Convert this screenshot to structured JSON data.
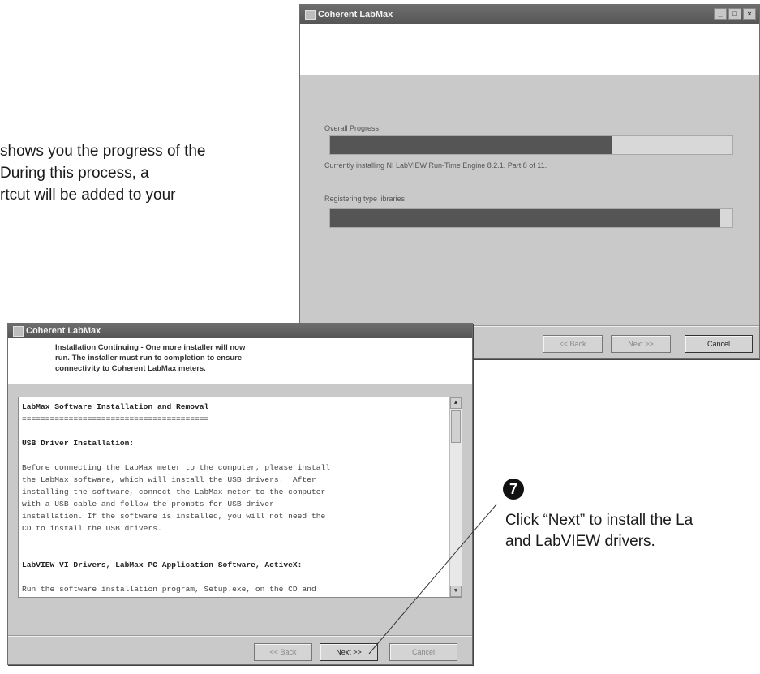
{
  "intro_caption": {
    "line1": "shows you the progress of the",
    "line2": "During this process, a",
    "line3": "rtcut will be added to your"
  },
  "progress_window": {
    "title": "Coherent LabMax",
    "title_buttons": [
      "_",
      "□",
      "×"
    ],
    "overall_label": "Overall Progress",
    "overall_progress": 0.7,
    "status_text": "Currently installing NI LabVIEW Run-Time Engine 8.2.1.  Part 8 of 11.",
    "sub_label": "Registering type libraries",
    "sub_progress": 0.97,
    "buttons": {
      "back": "<< Back",
      "next": "Next >>",
      "cancel": "Cancel"
    }
  },
  "install_window": {
    "title": "Coherent LabMax",
    "header_text": {
      "line1": "Installation Continuing - One more installer will now",
      "line2": "run.  The installer must run to completion to ensure",
      "line3": "connectivity to Coherent LabMax meters."
    },
    "readme_lines": [
      "LabMax Software Installation and Removal",
      "========================================",
      "",
      "USB Driver Installation:",
      "",
      "Before connecting the LabMax meter to the computer, please install",
      "the LabMax software, which will install the USB drivers.  After",
      "installing the software, connect the LabMax meter to the computer",
      "with a USB cable and follow the prompts for USB driver",
      "installation. If the software is installed, you will not need the",
      "CD to install the USB drivers.",
      "",
      "",
      "LabVIEW VI Drivers, LabMax PC Application Software, ActiveX:",
      "",
      "Run the software installation program, Setup.exe, on the CD and"
    ],
    "buttons": {
      "back": "<< Back",
      "next": "Next >>",
      "cancel": "Cancel"
    }
  },
  "step_callout": {
    "number": "7",
    "line1": "Click “Next” to install the La",
    "line2": "and LabVIEW drivers."
  }
}
